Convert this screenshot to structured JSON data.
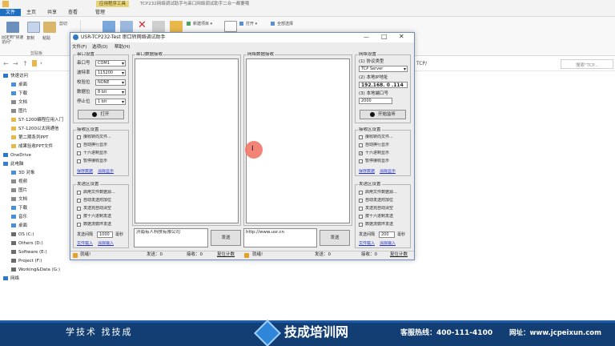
{
  "explorer": {
    "title_tab": "应用程序工具",
    "title_text": "TCP232网络调试助手与串口网络调试助手二合一都要哦",
    "tabs": [
      "文件",
      "主页",
      "共享",
      "查看",
      "管理"
    ],
    "ribbon": {
      "pin_label": "固定到\"快速访问\"",
      "copy_label": "复制",
      "paste_label": "粘贴",
      "cut_label": "剪切",
      "clipboard_group": "剪贴板",
      "new_item_label": "新建项目 ▾",
      "open_label": "打开 ▾",
      "select_all_label": "全部选择"
    },
    "address_arrow": "›",
    "address_text": "TCP/",
    "search_placeholder": "搜索\"TCP...",
    "nav": [
      {
        "label": "快速访问",
        "icon": "star-icon",
        "color": "#2b78c8"
      },
      {
        "label": "桌面",
        "icon": "folder-icon",
        "color": "#4a90d9"
      },
      {
        "label": "下载",
        "icon": "download-icon",
        "color": "#4a90d9"
      },
      {
        "label": "文档",
        "icon": "document-icon",
        "color": "#8a8a8a"
      },
      {
        "label": "图片",
        "icon": "picture-icon",
        "color": "#8a8a8a"
      },
      {
        "label": "S7-1200编程应用入门",
        "icon": "folder-icon",
        "color": "#e8b84a"
      },
      {
        "label": "S7-1200以太网通信",
        "icon": "folder-icon",
        "color": "#e8b84a"
      },
      {
        "label": "第二期系列PPT",
        "icon": "folder-icon",
        "color": "#e8b84a"
      },
      {
        "label": "成果验收PPT文件",
        "icon": "folder-icon",
        "color": "#e8b84a"
      },
      {
        "label": "OneDrive",
        "icon": "cloud-icon",
        "color": "#2b78c8"
      },
      {
        "label": "此电脑",
        "icon": "computer-icon",
        "color": "#3a7bd5"
      },
      {
        "label": "3D 对象",
        "icon": "cube-icon",
        "color": "#4a90d9"
      },
      {
        "label": "视频",
        "icon": "video-icon",
        "color": "#8a8a8a"
      },
      {
        "label": "图片",
        "icon": "picture-icon",
        "color": "#8a8a8a"
      },
      {
        "label": "文档",
        "icon": "document-icon",
        "color": "#8a8a8a"
      },
      {
        "label": "下载",
        "icon": "download-icon",
        "color": "#4a90d9"
      },
      {
        "label": "音乐",
        "icon": "music-icon",
        "color": "#4a90d9"
      },
      {
        "label": "桌面",
        "icon": "folder-icon",
        "color": "#4a90d9"
      },
      {
        "label": "OS (C:)",
        "icon": "drive-icon",
        "color": "#6b6b6b"
      },
      {
        "label": "Others (D:)",
        "icon": "drive-icon",
        "color": "#6b6b6b"
      },
      {
        "label": "Software (E:)",
        "icon": "drive-icon",
        "color": "#6b6b6b"
      },
      {
        "label": "Project (F:)",
        "icon": "drive-icon",
        "color": "#6b6b6b"
      },
      {
        "label": "Working&Data (G:)",
        "icon": "drive-icon",
        "color": "#6b6b6b"
      },
      {
        "label": "网络",
        "icon": "network-icon",
        "color": "#2b78c8"
      }
    ]
  },
  "app": {
    "title": "USR-TCP232-Test 串口转网络调试助手",
    "menu": [
      "文件(F)",
      "选项(O)",
      "帮助(H)"
    ],
    "serial_settings": {
      "group": "串口设置",
      "port_label": "串口号",
      "port_value": "COM1",
      "baud_label": "波特率",
      "baud_value": "115200",
      "parity_label": "校验位",
      "parity_value": "NONE",
      "data_label": "数据位",
      "data_value": "8 bit",
      "stop_label": "停止位",
      "stop_value": "1 bit",
      "open_button": "打开"
    },
    "serial_recv": {
      "group": "接收区设置",
      "options": [
        "接收转向文件...",
        "自动换行显示",
        "十六进制显示",
        "暂停接收显示"
      ],
      "checked": [
        false,
        false,
        false,
        false
      ],
      "save_link": "保存数据",
      "clear_link": "清除显示"
    },
    "serial_send": {
      "group": "发送区设置",
      "options": [
        "启用文件数据源...",
        "自动发送附加位",
        "发送完自动清空",
        "按十六进制发送",
        "数据流循环发送"
      ],
      "interval_label": "发送间隔",
      "interval_value": "1000",
      "interval_unit": "毫秒",
      "load_link": "文件载入",
      "clear_link": "清除输入"
    },
    "serial_recv_area_title": "串口数据接收",
    "serial_send_text": "济南有人科技有限公司",
    "serial_send_button": "发送",
    "net_recv_area_title": "网络数据接收",
    "net_send_text": "http://www.usr.cn",
    "net_send_button": "发送",
    "net_settings": {
      "group": "网络设置",
      "protocol_label": "(1) 协议类型",
      "protocol_value": "TCP Server",
      "ip_label": "(2) 本地IP地址",
      "ip_value": "192.168. 0 .114",
      "port_label": "(3) 本地端口号",
      "port_value": "2000",
      "listen_button": "开始监听"
    },
    "net_recv": {
      "group": "接收区设置",
      "options": [
        "接收转向文件...",
        "自动换行显示",
        "十六进制显示",
        "暂停接收显示"
      ],
      "checked": [
        false,
        false,
        true,
        false
      ],
      "save_link": "保存数据",
      "clear_link": "清除显示"
    },
    "net_send": {
      "group": "发送区设置",
      "options": [
        "启用文件数据源...",
        "自动发送附加位",
        "发送完自动清空",
        "按十六进制发送",
        "数据流循环发送"
      ],
      "interval_label": "发送间隔",
      "interval_value": "200",
      "interval_unit": "毫秒",
      "load_link": "文件载入",
      "clear_link": "清除输入"
    },
    "status_left": {
      "ready": "就绪!",
      "sent": "发送：0",
      "recv": "接收：0",
      "reset": "复位计数"
    },
    "status_right": {
      "ready": "就绪!",
      "sent": "发送：0",
      "recv": "接收：0",
      "reset": "复位计数"
    }
  },
  "banner": {
    "slogan_left": "学技术  找技成",
    "brand": "技成培训网",
    "hotline": "客服热线：400-111-4100",
    "website": "网址：www.jcpeixun.com",
    "bg_color": "#123e73",
    "accent_color": "#ffffff"
  },
  "cursor_glyph": "I"
}
